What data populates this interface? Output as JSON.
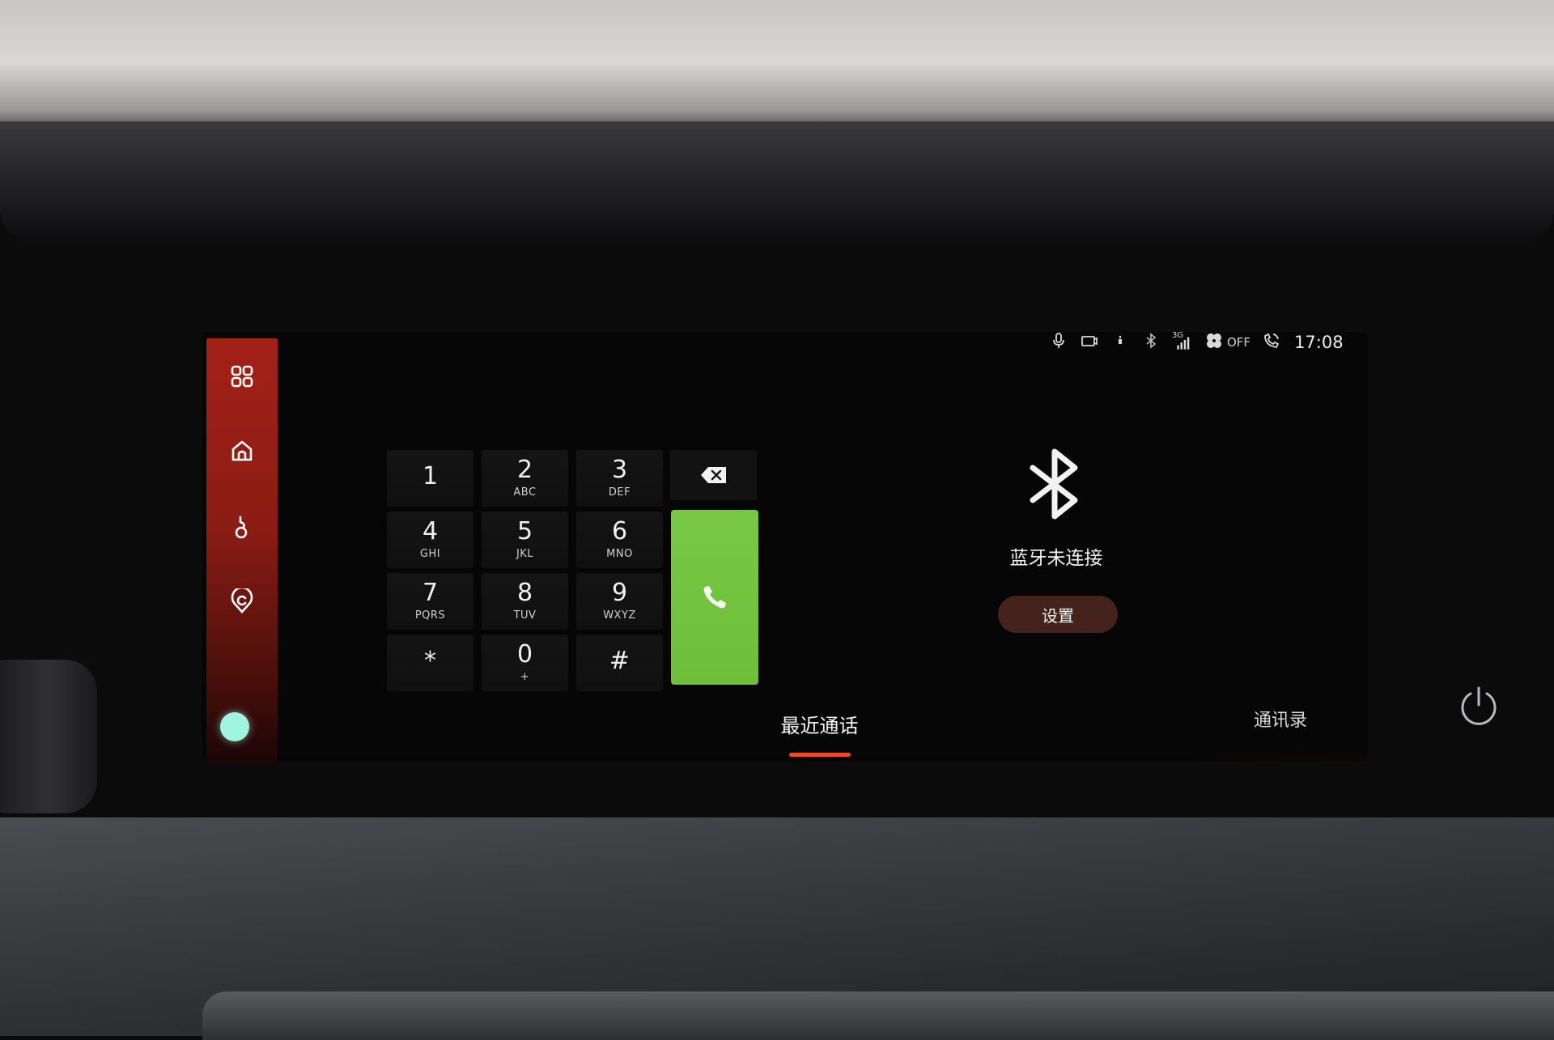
{
  "sidebar": {
    "items": [
      {
        "icon": "apps-grid-icon"
      },
      {
        "icon": "home-icon"
      },
      {
        "icon": "music-note-icon"
      },
      {
        "icon": "location-pin-icon"
      }
    ],
    "indicator_color": "#9ff5df"
  },
  "status_bar": {
    "icons": [
      "microphone-icon",
      "camera-icon",
      "signal-small-icon",
      "bluetooth-icon",
      "cellular-3g-icon",
      "fan-icon",
      "call-sync-icon"
    ],
    "network_label": "3G",
    "fan_state": "OFF",
    "time": "17:08"
  },
  "keypad": {
    "keys": [
      {
        "digit": "1",
        "letters": ""
      },
      {
        "digit": "2",
        "letters": "ABC"
      },
      {
        "digit": "3",
        "letters": "DEF"
      },
      {
        "digit": "4",
        "letters": "GHI"
      },
      {
        "digit": "5",
        "letters": "JKL"
      },
      {
        "digit": "6",
        "letters": "MNO"
      },
      {
        "digit": "7",
        "letters": "PQRS"
      },
      {
        "digit": "8",
        "letters": "TUV"
      },
      {
        "digit": "9",
        "letters": "WXYZ"
      },
      {
        "digit": "*",
        "letters": ""
      },
      {
        "digit": "0",
        "letters": "+"
      },
      {
        "digit": "#",
        "letters": ""
      }
    ],
    "call_color": "#79c843"
  },
  "bluetooth_panel": {
    "status": "蓝牙未连接",
    "settings_label": "设置"
  },
  "tabs": {
    "recent_calls": "最近通话",
    "contacts": "通讯录"
  },
  "colors": {
    "accent_red": "#a32117",
    "tab_underline": "#f04a24"
  }
}
